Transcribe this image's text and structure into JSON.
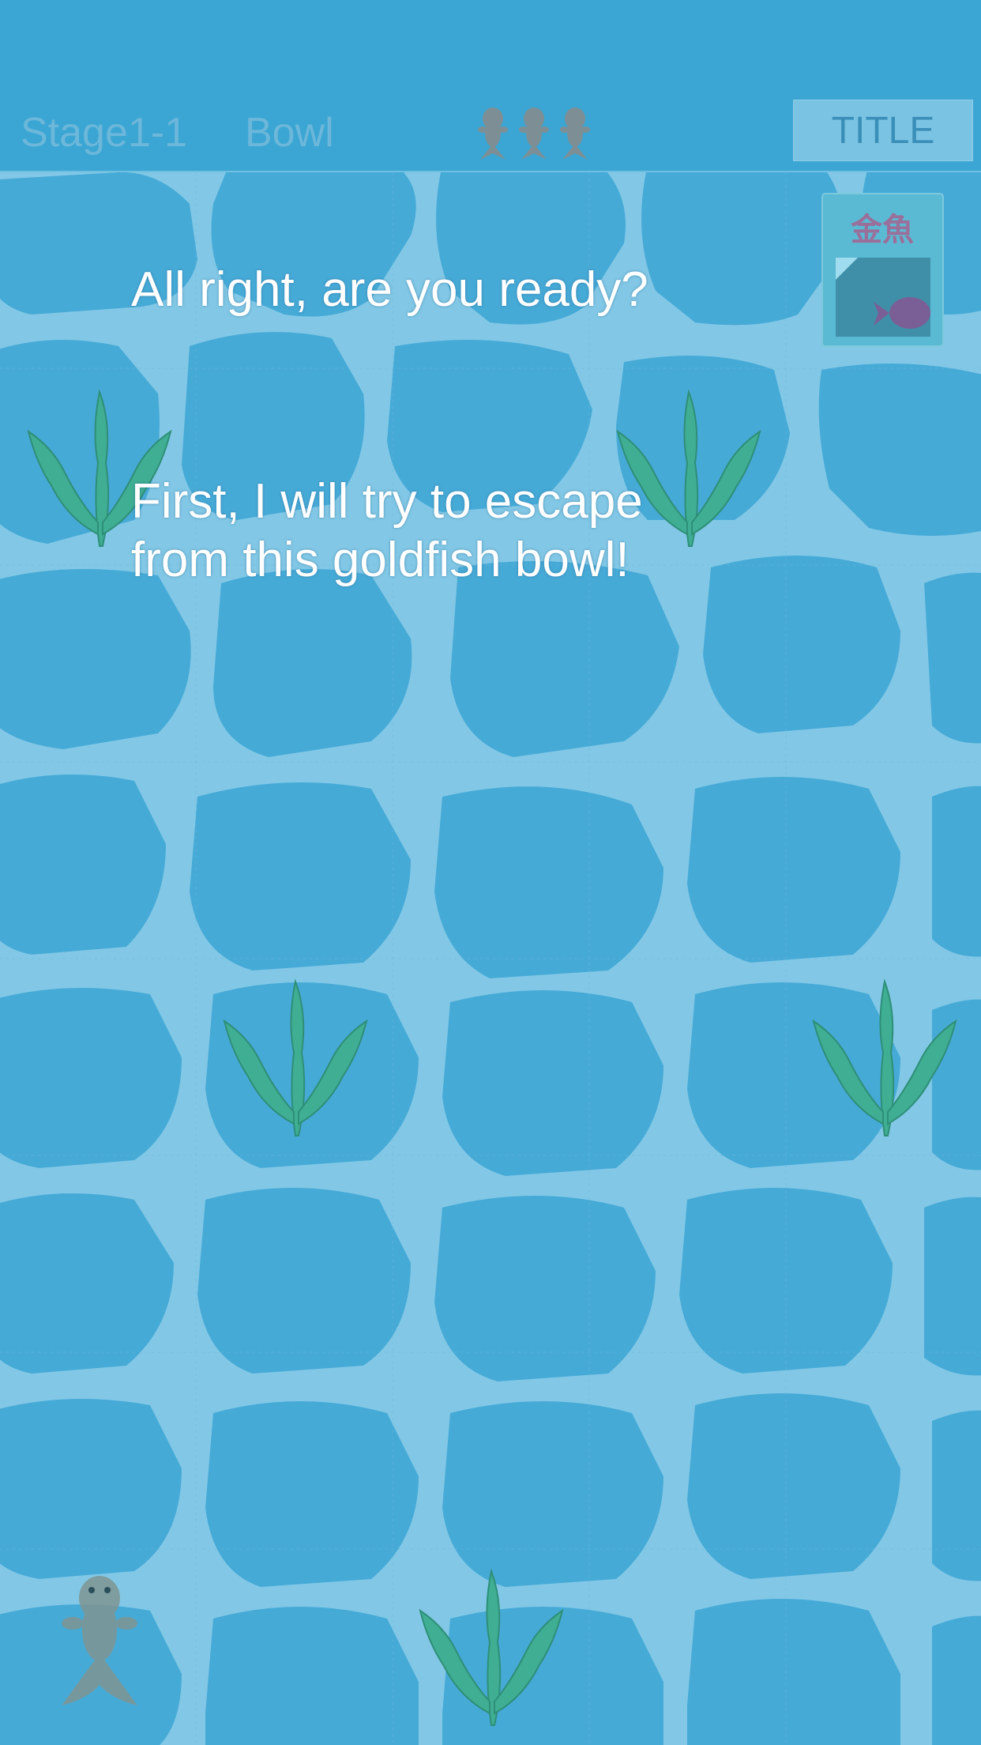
{
  "header": {
    "stage": "Stage1-1",
    "location": "Bowl",
    "lives_icon": "goldfish-icon",
    "lives_count": 3,
    "title_button": "TITLE"
  },
  "dialog": {
    "line1": "All right, are you ready?",
    "line2": "First, I will try to escape\nfrom this goldfish bowl!"
  },
  "badge": {
    "text": "金魚",
    "icon": "goldfish-card-icon"
  },
  "colors": {
    "water_base": "#82c8e6",
    "stone": "#46aad7",
    "weed": "#3fae92",
    "header": "#3ba6d3"
  }
}
